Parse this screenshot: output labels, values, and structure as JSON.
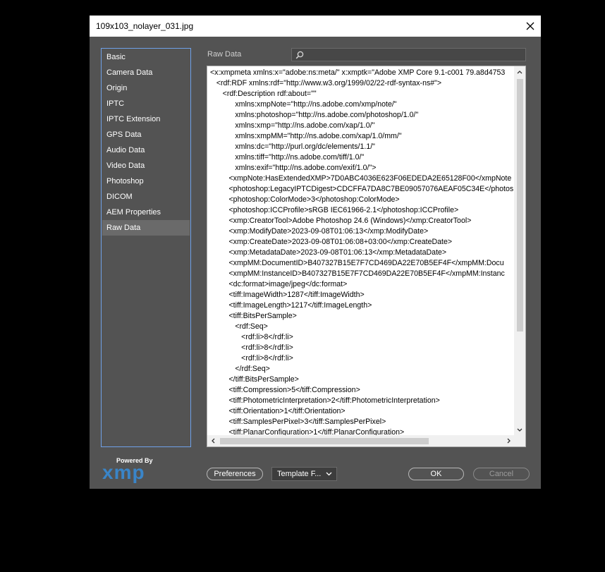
{
  "window": {
    "title": "109x103_nolayer_031.jpg"
  },
  "sidebar": {
    "items": [
      {
        "label": "Basic"
      },
      {
        "label": "Camera Data"
      },
      {
        "label": "Origin"
      },
      {
        "label": "IPTC"
      },
      {
        "label": "IPTC Extension"
      },
      {
        "label": "GPS Data"
      },
      {
        "label": "Audio Data"
      },
      {
        "label": "Video Data"
      },
      {
        "label": "Photoshop"
      },
      {
        "label": "DICOM"
      },
      {
        "label": "AEM Properties"
      },
      {
        "label": "Raw Data"
      }
    ],
    "selected": "Raw Data"
  },
  "main": {
    "section_label": "Raw Data",
    "search": {
      "value": "",
      "placeholder": ""
    },
    "raw_lines": [
      "<x:xmpmeta xmlns:x=\"adobe:ns:meta/\" x:xmptk=\"Adobe XMP Core 9.1-c001 79.a8d4753",
      "   <rdf:RDF xmlns:rdf=\"http://www.w3.org/1999/02/22-rdf-syntax-ns#\">",
      "      <rdf:Description rdf:about=\"\"",
      "            xmlns:xmpNote=\"http://ns.adobe.com/xmp/note/\"",
      "            xmlns:photoshop=\"http://ns.adobe.com/photoshop/1.0/\"",
      "            xmlns:xmp=\"http://ns.adobe.com/xap/1.0/\"",
      "            xmlns:xmpMM=\"http://ns.adobe.com/xap/1.0/mm/\"",
      "            xmlns:dc=\"http://purl.org/dc/elements/1.1/\"",
      "            xmlns:tiff=\"http://ns.adobe.com/tiff/1.0/\"",
      "            xmlns:exif=\"http://ns.adobe.com/exif/1.0/\">",
      "         <xmpNote:HasExtendedXMP>7D0ABC4036E623F06EDEDA2E65128F00</xmpNote",
      "         <photoshop:LegacyIPTCDigest>CDCFFA7DA8C7BE09057076AEAF05C34E</photos",
      "         <photoshop:ColorMode>3</photoshop:ColorMode>",
      "         <photoshop:ICCProfile>sRGB IEC61966-2.1</photoshop:ICCProfile>",
      "         <xmp:CreatorTool>Adobe Photoshop 24.6 (Windows)</xmp:CreatorTool>",
      "         <xmp:ModifyDate>2023-09-08T01:06:13</xmp:ModifyDate>",
      "         <xmp:CreateDate>2023-09-08T01:06:08+03:00</xmp:CreateDate>",
      "         <xmp:MetadataDate>2023-09-08T01:06:13</xmp:MetadataDate>",
      "         <xmpMM:DocumentID>B407327B15E7F7CD469DA22E70B5EF4F</xmpMM:Docu",
      "         <xmpMM:InstanceID>B407327B15E7F7CD469DA22E70B5EF4F</xmpMM:Instanc",
      "         <dc:format>image/jpeg</dc:format>",
      "         <tiff:ImageWidth>1287</tiff:ImageWidth>",
      "         <tiff:ImageLength>1217</tiff:ImageLength>",
      "         <tiff:BitsPerSample>",
      "            <rdf:Seq>",
      "               <rdf:li>8</rdf:li>",
      "               <rdf:li>8</rdf:li>",
      "               <rdf:li>8</rdf:li>",
      "            </rdf:Seq>",
      "         </tiff:BitsPerSample>",
      "         <tiff:Compression>5</tiff:Compression>",
      "         <tiff:PhotometricInterpretation>2</tiff:PhotometricInterpretation>",
      "         <tiff:Orientation>1</tiff:Orientation>",
      "         <tiff:SamplesPerPixel>3</tiff:SamplesPerPixel>",
      "         <tiff:PlanarConfiguration>1</tiff:PlanarConfiguration>"
    ]
  },
  "footer": {
    "powered_by": "Powered By",
    "logo_text": "xmp",
    "preferences_label": "Preferences",
    "template_label": "Template F...",
    "ok_label": "OK",
    "cancel_label": "Cancel"
  },
  "colors": {
    "accent": "#6fa1e8",
    "dialog_bg": "#535353",
    "xmp_logo": "#3a85c8"
  }
}
